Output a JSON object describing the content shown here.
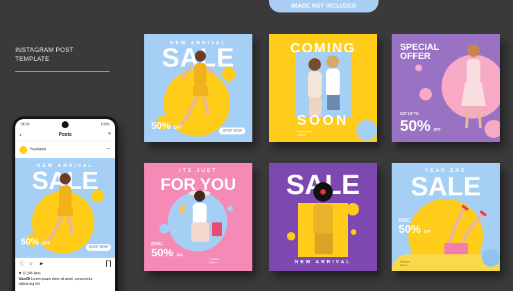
{
  "tag": "IMAGE NOT INCLUDED",
  "side_title": "INSTAGRAM POST\nTEMPLATE",
  "phone": {
    "status_time": "08:30",
    "status_battery": "100%",
    "header_title": "Posts",
    "username": "YourName",
    "post": {
      "kicker": "NEW ARRIVAL",
      "title": "SALE",
      "price": "50%",
      "price_suffix": "OFF",
      "button": "SHOP NOW"
    },
    "likes": "12,345 likes",
    "caption_user": "UserID",
    "caption_line1": "Lorem ipsum dolor sit amet, consectetur",
    "caption_line2": "adipiscing elit."
  },
  "cards": {
    "c1": {
      "kicker": "NEW ARRIVAL",
      "title": "SALE",
      "price": "50%",
      "price_suffix": "OFF",
      "button": "SHOP NOW",
      "bg": "#a5cff5",
      "accent": "#ffcc1a"
    },
    "c2": {
      "title_top": "COMING",
      "title_bottom": "SOON",
      "note": "Enthusiastic\nStarted",
      "bg": "#ffcc1a",
      "accent": "#a5cff5"
    },
    "c3": {
      "title": "SPECIAL\nOFFER",
      "get_up": "GET UP TO",
      "price": "50%",
      "price_suffix": "OFF",
      "bg": "#9a72c4",
      "accent": "#f7a9c6"
    },
    "c4": {
      "kicker": "ITS JUST",
      "title": "FOR YOU",
      "disc": "DISC.",
      "price": "50%",
      "price_suffix": "OFF",
      "note": "Product\nName",
      "bg": "#f48ab5",
      "accent": "#a5cff5"
    },
    "c5": {
      "title": "SALE",
      "bottom": "NEW ARRIVAL",
      "bg": "#7d48b0",
      "accent": "#ffcc1a"
    },
    "c6": {
      "kicker": "YEAR END",
      "title": "SALE",
      "disc": "DISC.",
      "price": "50%",
      "price_suffix": "OFF",
      "note": "Product\nName",
      "bg": "#a5cff5",
      "accent": "#ffcc1a"
    }
  }
}
